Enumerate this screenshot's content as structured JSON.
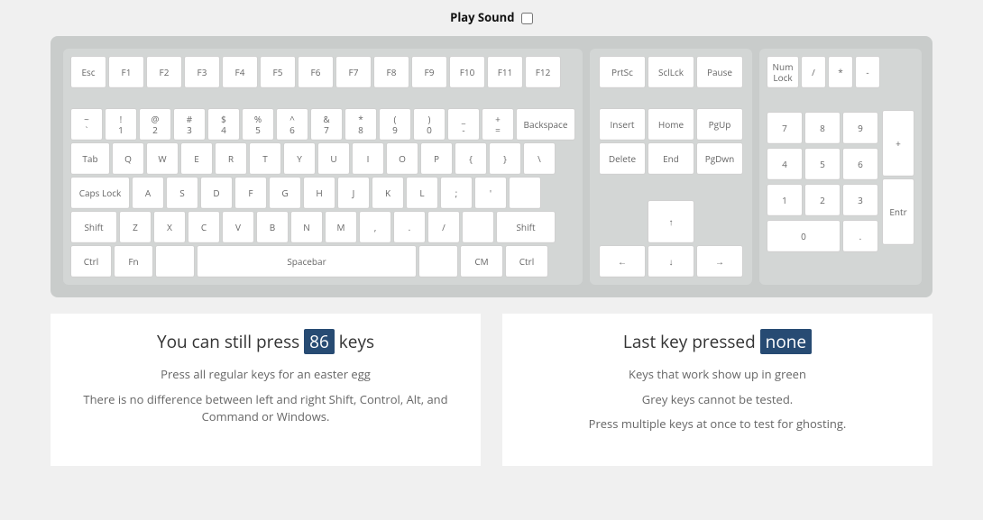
{
  "playSound": {
    "label": "Play Sound"
  },
  "keyboard": {
    "fnRow": [
      "Esc",
      "F1",
      "F2",
      "F3",
      "F4",
      "F5",
      "F6",
      "F7",
      "F8",
      "F9",
      "F10",
      "F11",
      "F12"
    ],
    "numRowTop": [
      "~",
      "!",
      "@",
      "#",
      "$",
      "%",
      "^",
      "&",
      "*",
      "(",
      ")",
      "_",
      "+"
    ],
    "numRowBottom": [
      "`",
      "1",
      "2",
      "3",
      "4",
      "5",
      "6",
      "7",
      "8",
      "9",
      "0",
      "-",
      "="
    ],
    "backspace": "Backspace",
    "tab": "Tab",
    "qRow": [
      "Q",
      "W",
      "E",
      "R",
      "T",
      "Y",
      "U",
      "I",
      "O",
      "P",
      "{",
      "}",
      "\\"
    ],
    "caps": "Caps Lock",
    "aRow": [
      "A",
      "S",
      "D",
      "F",
      "G",
      "H",
      "J",
      "K",
      "L",
      ";",
      "'"
    ],
    "shiftL": "Shift",
    "zRow": [
      "Z",
      "X",
      "C",
      "V",
      "B",
      "N",
      "M",
      ",",
      ".",
      "/"
    ],
    "shiftR": "Shift",
    "bottom": {
      "ctrlL": "Ctrl",
      "fn": "Fn",
      "space": "Spacebar",
      "cm": "CM",
      "ctrlR": "Ctrl"
    },
    "nav1": [
      "PrtSc",
      "SclLck",
      "Pause"
    ],
    "nav2": [
      "Insert",
      "Home",
      "PgUp"
    ],
    "nav3": [
      "Delete",
      "End",
      "PgDwn"
    ],
    "arrows": {
      "up": "↑",
      "left": "←",
      "down": "↓",
      "right": "→"
    },
    "numTop": [
      "Num Lock",
      "/",
      "*",
      "-"
    ],
    "numR1": [
      "7",
      "8",
      "9"
    ],
    "numR2": [
      "4",
      "5",
      "6"
    ],
    "numR3": [
      "1",
      "2",
      "3"
    ],
    "numR4": [
      "0",
      "."
    ],
    "numPlus": "+",
    "numEnter": "Entr"
  },
  "leftCard": {
    "titleA": "You can still press",
    "count": "86",
    "titleB": "keys",
    "p1": "Press all regular keys for an easter egg",
    "p2": "There is no difference between left and right Shift, Control, Alt, and Command or Windows."
  },
  "rightCard": {
    "titleA": "Last key pressed",
    "value": "none",
    "p1": "Keys that work show up in green",
    "p2": "Grey keys cannot be tested.",
    "p3": "Press multiple keys at once to test for ghosting."
  }
}
